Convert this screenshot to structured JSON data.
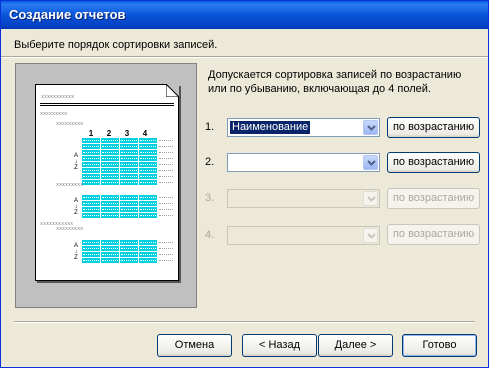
{
  "window": {
    "title": "Создание отчетов"
  },
  "prompt": "Выберите порядок сортировки записей.",
  "description": "Допускается сортировка записей по возрастанию или по убыванию, включающая до 4 полей.",
  "preview": {
    "placeholder": "xxxxxxxxxxx",
    "column_numbers": [
      "1",
      "2",
      "3",
      "4"
    ],
    "sort_glyph": "A↓Z"
  },
  "sort_rows": [
    {
      "number": "1.",
      "field": "Наименование",
      "order": "по возрастанию",
      "enabled": true
    },
    {
      "number": "2.",
      "field": "",
      "order": "по возрастанию",
      "enabled": true
    },
    {
      "number": "3.",
      "field": "",
      "order": "по возрастанию",
      "enabled": false
    },
    {
      "number": "4.",
      "field": "",
      "order": "по возрастанию",
      "enabled": false
    }
  ],
  "buttons": {
    "cancel": "Отмена",
    "back": "< Назад",
    "next": "Далее >",
    "finish": "Готово"
  },
  "colors": {
    "accent": "#0a54d8",
    "preview_cells": "#00d0e0",
    "face": "#ece9d8"
  }
}
